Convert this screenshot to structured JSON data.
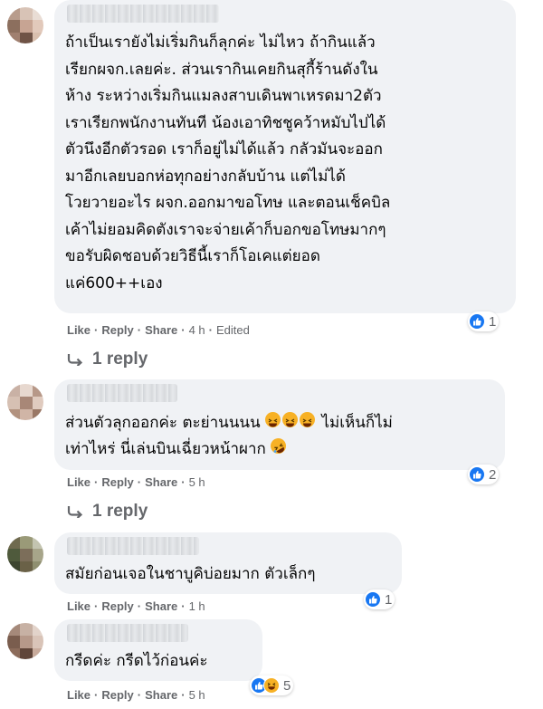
{
  "comments": [
    {
      "lines": [
        "ถ้าเป็นเรายังไม่เริ่มกินก็ลุกค่ะ ไม่ไหว ถ้ากินแล้ว",
        "เรียกผจก.เลยค่ะ. ส่วนเรากินเคยกินสุกี้ร้านดังใน",
        "ห้าง ระหว่างเริ่มกินแมลงสาบเดินพาเหรดมา2ตัว",
        "เราเรียกพนักงานทันที น้องเอาทิชชูคว้าหมับไปได้",
        "ตัวนึงอีกตัวรอด เราก็อยู่ไม่ได้แล้ว กลัวมันจะออก",
        "มาอีกเลยบอกห่อทุกอย่างกลับบ้าน แต่ไม่ได้",
        "โวยวายอะไร ผจก.ออกมาขอโทษ และตอนเช็คบิล",
        "เค้าไม่ยอมคิดตังเราจะจ่ายเค้าก็บอกขอโทษมากๆ",
        "ขอรับผิดชอบด้วยวิธีนี้เราก็โอเคแต่ยอด",
        "แค่600++เอง"
      ],
      "actions": {
        "like": "Like",
        "reply": "Reply",
        "share": "Share",
        "time": "4 h",
        "edited": "Edited"
      },
      "reaction_count": "1",
      "replies_label": "1 reply"
    },
    {
      "line1": "ส่วนตัวลุกออกค่ะ ตะย่านนนน",
      "line1_after": "ไม่เห็นก็ไม่",
      "line2": "เท่าไหร่ นี่เล่นบินเฉี่ยวหน้าผาก",
      "actions": {
        "like": "Like",
        "reply": "Reply",
        "share": "Share",
        "time": "5 h"
      },
      "reaction_count": "2",
      "replies_label": "1 reply"
    },
    {
      "lines": [
        "สมัยก่อนเจอในชาบูคิบ่อยมาก ตัวเล็กๆ"
      ],
      "actions": {
        "like": "Like",
        "reply": "Reply",
        "share": "Share",
        "time": "1 h"
      },
      "reaction_count": "1"
    },
    {
      "lines": [
        "กรีดค่ะ กรีดไว้ก่อนค่ะ"
      ],
      "actions": {
        "like": "Like",
        "reply": "Reply",
        "share": "Share",
        "time": "5 h"
      },
      "reaction_count": "5"
    }
  ],
  "icons": {
    "like": "like-reaction-icon",
    "haha": "haha-reaction-icon",
    "reply": "reply-arrow-icon",
    "grin": "grinning-squinting-emoji",
    "rofl": "rolling-laughing-emoji"
  },
  "colors": {
    "bubble": "#f0f2f5",
    "meta": "#65676b",
    "like_blue": "#1877f2",
    "emoji_yellow": "#f7b125"
  }
}
